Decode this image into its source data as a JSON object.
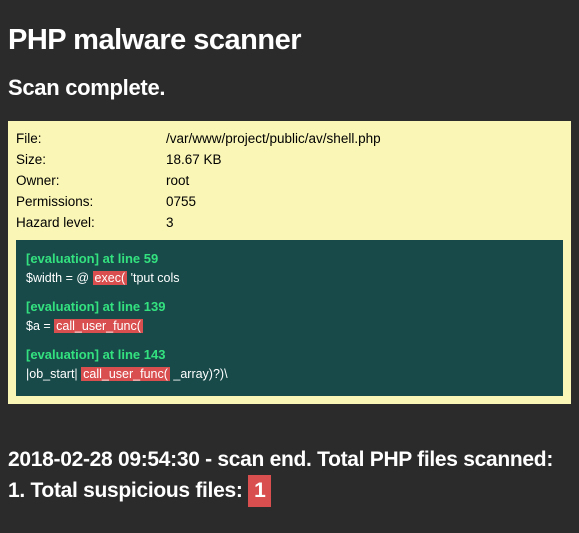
{
  "title": "PHP malware scanner",
  "status": "Scan complete.",
  "file": {
    "labels": {
      "file": "File:",
      "size": "Size:",
      "owner": "Owner:",
      "permissions": "Permissions:",
      "hazard": "Hazard level:"
    },
    "values": {
      "file": "/var/www/project/public/av/shell.php",
      "size": "18.67 KB",
      "owner": "root",
      "permissions": "0755",
      "hazard": "3"
    }
  },
  "findings": [
    {
      "head": "[evaluation] at line 59",
      "pre": "$width = @ ",
      "hl": "exec(",
      "post": " 'tput cols"
    },
    {
      "head": "[evaluation] at line 139",
      "pre": "$a = ",
      "hl": "call_user_func(",
      "post": ""
    },
    {
      "head": "[evaluation] at line 143",
      "pre": "|ob_start| ",
      "hl": "call_user_func(",
      "post": " _array)?)\\"
    }
  ],
  "summary": {
    "timestamp": "2018-02-28 09:54:30",
    "sep": " - ",
    "msg1": "scan end. Total PHP files scanned: ",
    "count_files": "1",
    "msg2": ". Total suspicious files: ",
    "count_susp": "1"
  }
}
